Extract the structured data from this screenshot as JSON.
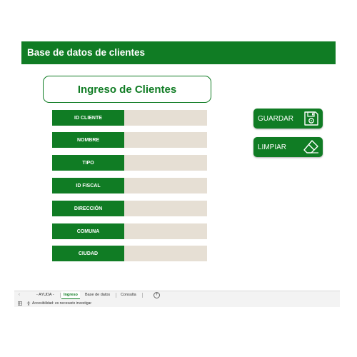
{
  "header": {
    "title": "Base de datos de clientes"
  },
  "form": {
    "title": "Ingreso de Clientes",
    "fields": [
      {
        "label": "ID CLIENTE",
        "value": ""
      },
      {
        "label": "NOMBRE",
        "value": ""
      },
      {
        "label": "TIPO",
        "value": ""
      },
      {
        "label": "ID FISCAL",
        "value": ""
      },
      {
        "label": "DIRECCIÓN",
        "value": ""
      },
      {
        "label": "COMUNA",
        "value": ""
      },
      {
        "label": "CIUDAD",
        "value": ""
      }
    ]
  },
  "actions": {
    "save": {
      "label": "GUARDAR",
      "icon": "floppy-disk-icon"
    },
    "clear": {
      "label": "LIMPIAR",
      "icon": "eraser-icon"
    }
  },
  "sheet_tabs": [
    {
      "label": "- AYUDA -",
      "active": false
    },
    {
      "label": "Ingreso",
      "active": true
    },
    {
      "label": "Base de datos",
      "active": false
    },
    {
      "label": "Consulta",
      "active": false
    }
  ],
  "status_bar": {
    "accessibility_text": "Accesibilidad: es necesario investigar"
  },
  "colors": {
    "accent": "#107c24",
    "input_bg": "#e6dfd4"
  }
}
